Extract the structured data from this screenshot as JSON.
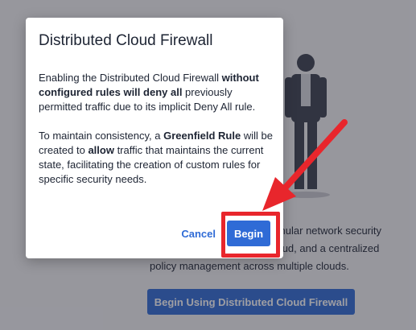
{
  "background": {
    "description_lines": [
      "ranular network security",
      "he cloud, and a centralized",
      "policy management across multiple clouds."
    ],
    "cta_label": "Begin Using Distributed Cloud Firewall"
  },
  "modal": {
    "title": "Distributed Cloud Firewall",
    "para1": {
      "t1": "Enabling the Distributed Cloud Firewall ",
      "b1": "without configured rules will deny all",
      "t2": " previously permitted traffic due to its implicit Deny All rule."
    },
    "para2": {
      "t1": "To maintain consistency, a ",
      "b1": "Greenfield Rule",
      "t2": " will be created to ",
      "b2": "allow",
      "t3": " traffic that maintains the current state, facilitating the creation of custom rules for specific security needs."
    },
    "cancel_label": "Cancel",
    "begin_label": "Begin"
  },
  "colors": {
    "accent": "#2f6bd6",
    "annotation": "#e8262c"
  }
}
